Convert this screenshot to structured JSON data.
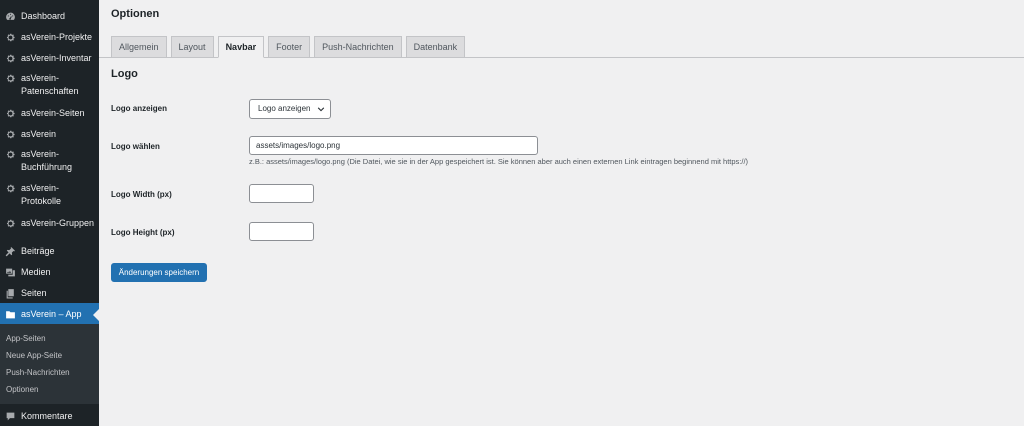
{
  "sidebar": {
    "items": [
      {
        "label": "Dashboard",
        "icon": "dashboard-icon"
      },
      {
        "label": "asVerein-Projekte",
        "icon": "gear-icon"
      },
      {
        "label": "asVerein-Inventar",
        "icon": "gear-icon"
      },
      {
        "label_line1": "asVerein-",
        "label_line2": "Patenschaften",
        "icon": "gear-icon"
      },
      {
        "label": "asVerein-Seiten",
        "icon": "gear-icon"
      },
      {
        "label": "asVerein",
        "icon": "gear-icon"
      },
      {
        "label_line1": "asVerein-",
        "label_line2": "Buchführung",
        "icon": "gear-icon"
      },
      {
        "label_line1": "asVerein-",
        "label_line2": "Protokolle",
        "icon": "gear-icon"
      },
      {
        "label": "asVerein-Gruppen",
        "icon": "gear-icon"
      },
      {
        "label": "Beiträge",
        "icon": "pin-icon"
      },
      {
        "label": "Medien",
        "icon": "media-icon"
      },
      {
        "label": "Seiten",
        "icon": "pages-icon"
      },
      {
        "label": "asVerein – App",
        "icon": "folder-icon"
      },
      {
        "label": "Kommentare",
        "icon": "comment-icon"
      }
    ],
    "submenu": [
      "App-Seiten",
      "Neue App-Seite",
      "Push-Nachrichten",
      "Optionen"
    ]
  },
  "page": {
    "title": "Optionen",
    "tabs": [
      "Allgemein",
      "Layout",
      "Navbar",
      "Footer",
      "Push-Nachrichten",
      "Datenbank"
    ],
    "active_tab": "Navbar",
    "section_title": "Logo"
  },
  "form": {
    "logo_anzeigen_label": "Logo anzeigen",
    "logo_anzeigen_value": "Logo anzeigen",
    "logo_waehlen_label": "Logo wählen",
    "logo_waehlen_value": "assets/images/logo.png",
    "logo_waehlen_hint": "z.B.: assets/images/logo.png (Die Datei, wie sie in der App gespeichert ist. Sie können aber auch einen externen Link eintragen beginnend mit https://)",
    "logo_width_label": "Logo Width (px)",
    "logo_width_value": "",
    "logo_height_label": "Logo Height (px)",
    "logo_height_value": "",
    "save_label": "Änderungen speichern"
  },
  "colors": {
    "sidebar_bg": "#1d2327",
    "submenu_bg": "#2c3338",
    "accent": "#2271b1",
    "content_bg": "#f0f0f1"
  }
}
